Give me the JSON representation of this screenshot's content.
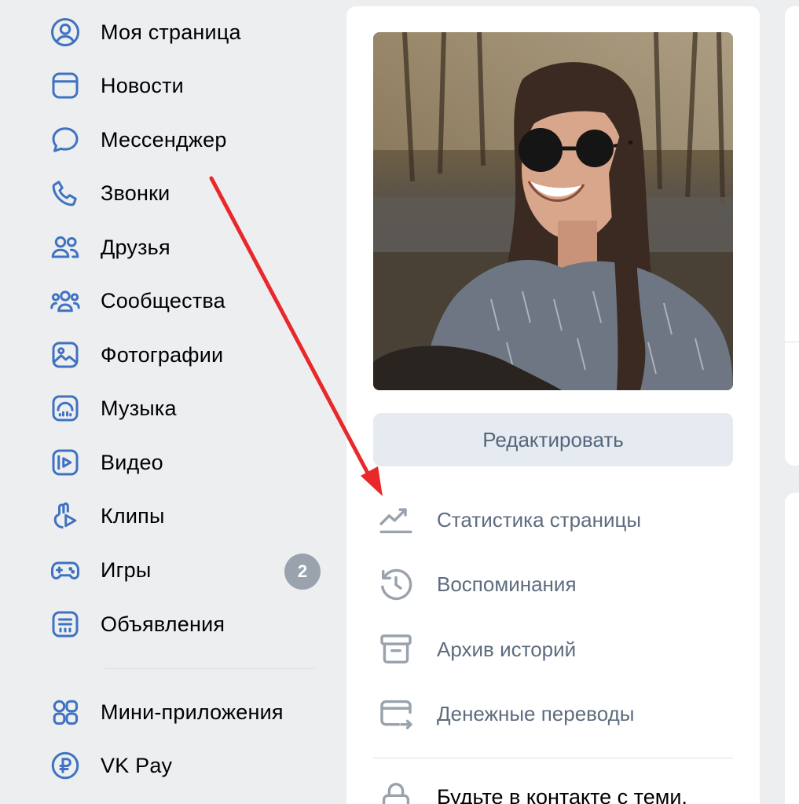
{
  "sidebar": {
    "items": [
      {
        "label": "Моя страница",
        "icon": "user-circle-icon"
      },
      {
        "label": "Новости",
        "icon": "news-icon"
      },
      {
        "label": "Мессенджер",
        "icon": "message-icon"
      },
      {
        "label": "Звонки",
        "icon": "phone-icon"
      },
      {
        "label": "Друзья",
        "icon": "friends-icon"
      },
      {
        "label": "Сообщества",
        "icon": "communities-icon"
      },
      {
        "label": "Фотографии",
        "icon": "photo-icon"
      },
      {
        "label": "Музыка",
        "icon": "music-icon"
      },
      {
        "label": "Видео",
        "icon": "video-icon"
      },
      {
        "label": "Клипы",
        "icon": "clips-icon"
      },
      {
        "label": "Игры",
        "icon": "gamepad-icon",
        "badge": "2"
      },
      {
        "label": "Объявления",
        "icon": "classifieds-icon"
      },
      {
        "label": "Мини-приложения",
        "icon": "apps-icon"
      },
      {
        "label": "VK Pay",
        "icon": "vkpay-icon"
      }
    ]
  },
  "profile": {
    "edit_label": "Редактировать",
    "menu": [
      {
        "label": "Статистика страницы",
        "icon": "stats-chart-icon"
      },
      {
        "label": "Воспоминания",
        "icon": "history-clock-icon"
      },
      {
        "label": "Архив историй",
        "icon": "archive-box-icon"
      },
      {
        "label": "Денежные переводы",
        "icon": "money-transfer-icon"
      }
    ],
    "bottom_text": "Будьте в контакте с теми,"
  },
  "colors": {
    "accent": "#3f72c0",
    "annotation_arrow": "#e8282b",
    "badge": "#99a2ad"
  }
}
